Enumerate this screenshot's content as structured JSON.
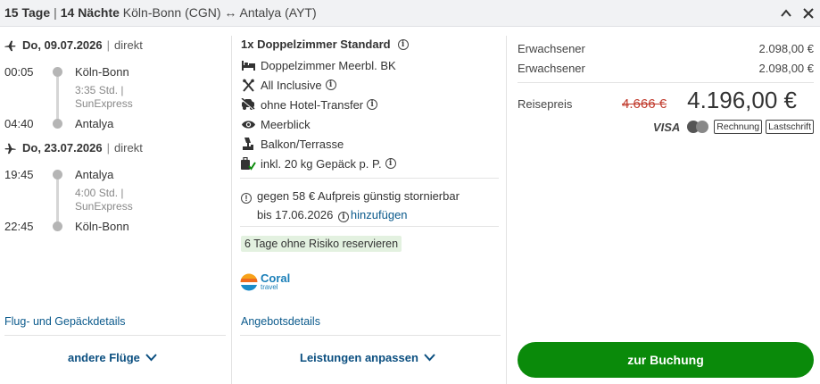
{
  "header": {
    "duration_days": "15 Tage",
    "duration_nights": "14 Nächte",
    "origin": "Köln-Bonn (CGN)",
    "arrow": "↔",
    "destination": "Antalya (AYT)"
  },
  "outbound": {
    "date": "Do, 09.07.2026",
    "type": "direkt",
    "dep_time": "00:05",
    "dep_airport": "Köln-Bonn",
    "duration": "3:35 Std. |",
    "airline": "SunExpress",
    "arr_time": "04:40",
    "arr_airport": "Antalya"
  },
  "return": {
    "date": "Do, 23.07.2026",
    "type": "direkt",
    "dep_time": "19:45",
    "dep_airport": "Antalya",
    "duration": "4:00 Std. |",
    "airline": "SunExpress",
    "arr_time": "22:45",
    "arr_airport": "Köln-Bonn"
  },
  "flight_links": {
    "details": "Flug- und Gepäckdetails",
    "other_flights": "andere Flüge"
  },
  "offer": {
    "title": "1x Doppelzimmer Standard",
    "features": [
      {
        "icon": "bed-icon",
        "label": "Doppelzimmer Meerbl. BK"
      },
      {
        "icon": "cutlery-icon",
        "label": "All Inclusive"
      },
      {
        "icon": "no-transfer-icon",
        "label": "ohne Hotel-Transfer"
      },
      {
        "icon": "eye-icon",
        "label": "Meerblick"
      },
      {
        "icon": "balcony-icon",
        "label": "Balkon/Terrasse"
      },
      {
        "icon": "luggage-icon",
        "label": "inkl. 20 kg Gepäck p. P."
      }
    ],
    "cancel_text": "gegen 58 € Aufpreis günstig stornierbar",
    "cancel_until": "bis 17.06.2026",
    "cancel_add": "hinzufügen",
    "risk_free": "6 Tage ohne Risiko reservieren",
    "operator": "Coral",
    "operator_sub": "travel",
    "details_link": "Angebotsdetails",
    "customize": "Leistungen anpassen"
  },
  "price": {
    "pax": [
      {
        "label": "Erwachsener",
        "price": "2.098,00 €"
      },
      {
        "label": "Erwachsener",
        "price": "2.098,00 €"
      }
    ],
    "total_label": "Reisepreis",
    "old_price": "4.666 €",
    "new_price": "4.196,00 €",
    "payment": {
      "visa": "VISA",
      "invoice": "Rechnung",
      "debit": "Lastschrift"
    },
    "book_button": "zur Buchung"
  },
  "colors": {
    "accent_link": "#0b5a8c",
    "book_button": "#0a8a0a",
    "old_price": "#c0392b",
    "risk_badge_bg": "#e3f1e0"
  }
}
